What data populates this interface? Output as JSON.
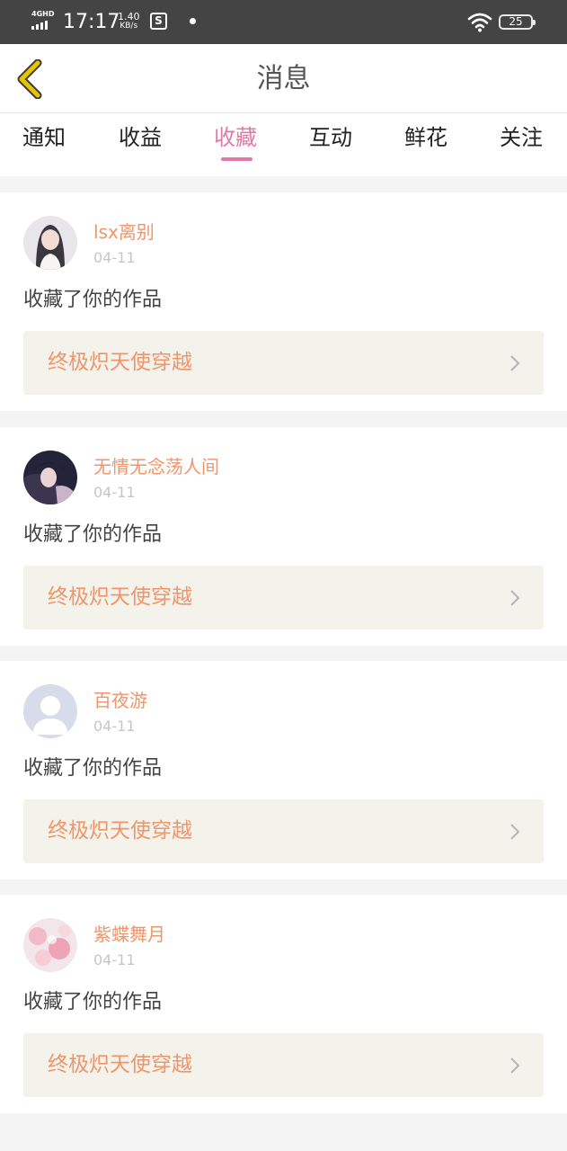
{
  "status_bar": {
    "network": "4GHD",
    "time": "17:17",
    "speed_value": "1.40",
    "speed_unit": "KB/s",
    "app_icon_letter": "S",
    "battery": "25",
    "icons": [
      "signal-icon",
      "app-notification-icon",
      "wifi-icon",
      "battery-icon"
    ]
  },
  "header": {
    "title": "消息",
    "back_icon": "chevron-left-icon",
    "back_icon_color": "#e8c400"
  },
  "tabs": [
    {
      "label": "通知"
    },
    {
      "label": "收益"
    },
    {
      "label": "收藏",
      "active": true
    },
    {
      "label": "互动"
    },
    {
      "label": "鲜花"
    },
    {
      "label": "关注"
    }
  ],
  "colors": {
    "accent": "#e27aa8",
    "username": "#f0956a",
    "work_bg": "#f3f3ec"
  },
  "notifications": [
    {
      "username": "lsx离别",
      "date": "04-11",
      "action": "收藏了你的作品",
      "work_title": "终极炽天使穿越",
      "avatar": "avatar-photo"
    },
    {
      "username": "无情无念荡人间",
      "date": "04-11",
      "action": "收藏了你的作品",
      "work_title": "终极炽天使穿越",
      "avatar": "avatar-photo"
    },
    {
      "username": "百夜游",
      "date": "04-11",
      "action": "收藏了你的作品",
      "work_title": "终极炽天使穿越",
      "avatar": "default-avatar-icon"
    },
    {
      "username": "紫蝶舞月",
      "date": "04-11",
      "action": "收藏了你的作品",
      "work_title": "终极炽天使穿越",
      "avatar": "avatar-photo"
    }
  ]
}
